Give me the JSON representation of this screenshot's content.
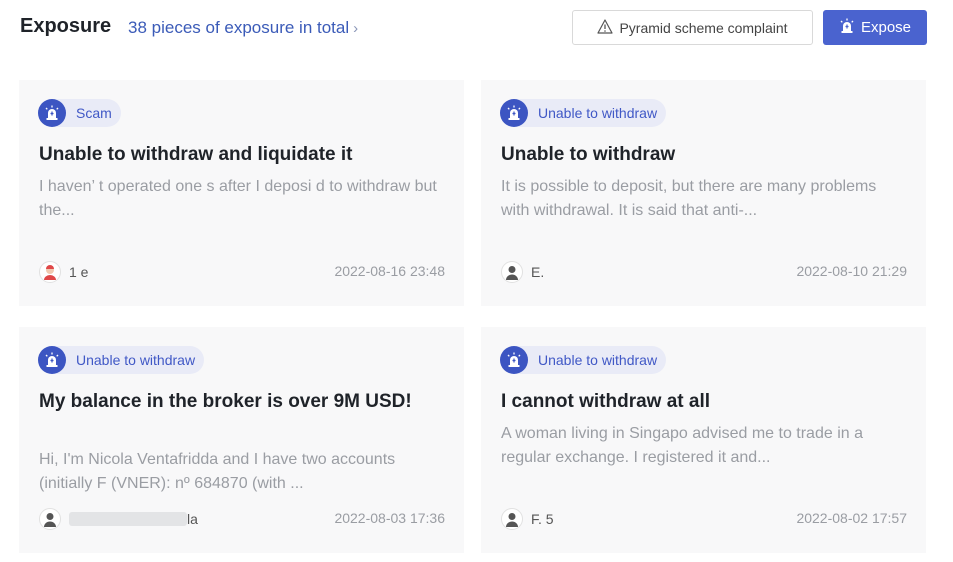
{
  "header": {
    "title": "Exposure",
    "total_link": "38 pieces of exposure in total",
    "complaint_button": "Pyramid scheme complaint",
    "expose_button": "Expose"
  },
  "colors": {
    "accent": "#4a63cf",
    "tag_background": "#e9ebf7",
    "card_background": "#f8f8f9"
  },
  "cards": [
    {
      "tag": "Scam",
      "title": "Unable to withdraw and liquidate it",
      "body": "I haven’ t operated one  s after I deposi  d to withdraw but the...",
      "author": "1  e",
      "date": "2022-08-16 23:48",
      "avatar_icon": "user-avatar-red-icon"
    },
    {
      "tag": "Unable to withdraw",
      "title": "Unable to withdraw",
      "body": "It is possible to deposit, but there are many problems with withdrawal. It is said that anti-...",
      "author": "E.",
      "date": "2022-08-10 21:29",
      "avatar_icon": "user-avatar-icon"
    },
    {
      "tag": "Unable to withdraw",
      "title": "My balance in the broker is over 9M USD!",
      "body": "Hi, I'm Nicola Ventafridda and I have two  accounts (initially F  (VNER): nº 684870 (with ...",
      "author": "la",
      "date": "2022-08-03 17:36",
      "avatar_icon": "user-avatar-icon"
    },
    {
      "tag": "Unable to withdraw",
      "title": "I cannot withdraw at all",
      "body": "A woman living in Singapo  advised me to trade in a regular exchange. I registered it and...",
      "author": "F.  5",
      "date": "2022-08-02 17:57",
      "avatar_icon": "user-avatar-icon"
    }
  ]
}
